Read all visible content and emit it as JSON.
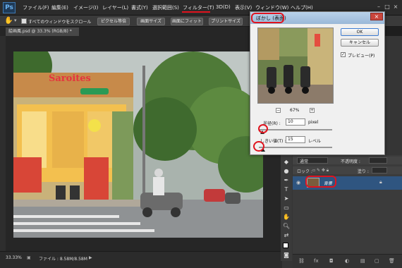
{
  "app": {
    "logo": "Ps"
  },
  "menu": {
    "items": [
      "ファイル(F)",
      "編集(E)",
      "イメージ(I)",
      "レイヤー(L)",
      "書式(Y)",
      "選択範囲(S)",
      "フィルター(T)",
      "3D(D)",
      "表示(V)",
      "ウィンドウ(W)",
      "ヘルプ(H)"
    ],
    "highlighted": "フィルター(T)"
  },
  "options": {
    "scroll_all_label": "すべてのウィンドウをスクロール",
    "buttons": [
      "ピクセル等倍",
      "画面サイズ",
      "画面にフィット",
      "プリントサイズ"
    ]
  },
  "document": {
    "tab_title": "絵画風.psd @ 33.3% (RGB/8) *",
    "zoom": "33.33%",
    "file_info": "ファイル : 8.58M/8.58M"
  },
  "photo": {
    "sign_text": "Saroites"
  },
  "dialog": {
    "title": "ぼかし (表面)",
    "ok_label": "OK",
    "cancel_label": "キャンセル",
    "preview_label": "プレビュー(P)",
    "preview_checked": "✓",
    "zoom": "67%",
    "zoom_minus": "−",
    "zoom_plus": "+",
    "radius_label": "半径(R) :",
    "radius_value": "10",
    "radius_unit": "pixel",
    "threshold_label": "しきい値(T) :",
    "threshold_value": "15",
    "threshold_unit": "レベル",
    "radius_slider_fraction": 0.05,
    "threshold_slider_fraction": 0.06
  },
  "layers": {
    "blend_mode": "通常",
    "opacity_label": "不透明度 :",
    "lock_label": "ロック :",
    "fill_label": "塗り :",
    "layer_name": "背景"
  },
  "colors": {
    "highlight": "#e0131e",
    "selected_layer": "#2f5580"
  }
}
